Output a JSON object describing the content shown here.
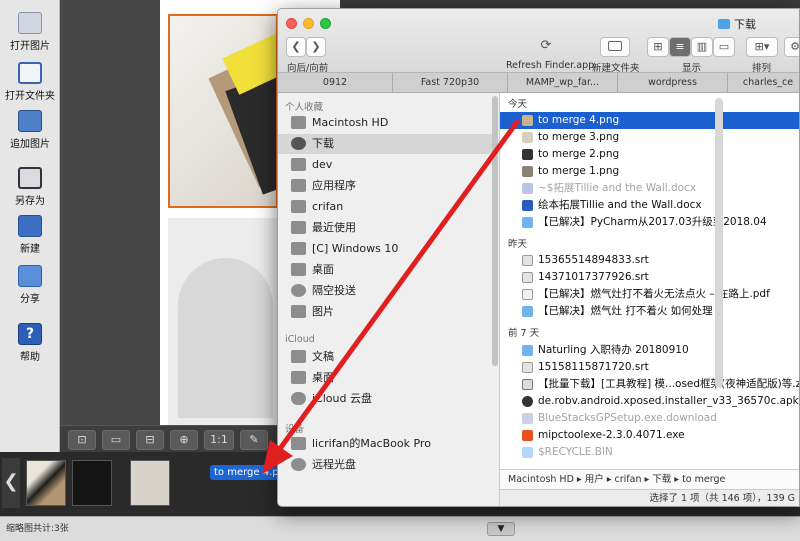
{
  "app": {
    "toolbar": [
      {
        "label": "打开图片",
        "icon": "open-image-icon"
      },
      {
        "label": "打开文件夹",
        "icon": "open-folder-icon"
      },
      {
        "label": "追加图片",
        "icon": "add-image-icon"
      },
      {
        "label": "另存为",
        "icon": "save-as-icon"
      },
      {
        "label": "新建",
        "icon": "new-icon"
      },
      {
        "label": "分享",
        "icon": "share-icon"
      },
      {
        "label": "帮助",
        "icon": "help-icon"
      }
    ],
    "bottom_tools": [
      "⊡",
      "▭",
      "⊟",
      "⊕",
      "1:1",
      "✎"
    ],
    "drag_label": "to merge 4.png",
    "status_text": "缩略图共计:3张",
    "collapse_icon": "▼",
    "nav_left": "❮"
  },
  "finder": {
    "title": "下载",
    "toolbar": {
      "back_forward": "向后/向前",
      "back": "❮",
      "forward": "❯",
      "refresh": "Refresh Finder.app",
      "new_folder": "新建文件夹",
      "display": "显示",
      "arrange": "排列"
    },
    "tabs": [
      "0912",
      "Fast 720p30",
      "MAMP_wp_far...",
      "wordpress",
      "charles_ce"
    ],
    "sidebar": {
      "favorites_header": "个人收藏",
      "favorites": [
        "Macintosh HD",
        "下载",
        "dev",
        "应用程序",
        "crifan",
        "最近使用",
        "[C] Windows 10",
        "桌面",
        "隔空投送",
        "图片"
      ],
      "icloud_header": "iCloud",
      "icloud": [
        "文稿",
        "桌面",
        "iCloud 云盘"
      ],
      "devices_header": "设备",
      "devices": [
        "licrifan的MacBook Pro",
        "远程光盘"
      ]
    },
    "groups": [
      {
        "header": "今天",
        "files": [
          {
            "name": "to merge 4.png",
            "selected": true
          },
          {
            "name": "to merge 3.png"
          },
          {
            "name": "to merge 2.png"
          },
          {
            "name": "to merge 1.png"
          },
          {
            "name": "~$拓展Tillie and the Wall.docx",
            "dim": true
          },
          {
            "name": "绘本拓展Tillie and the Wall.docx"
          },
          {
            "name": "【已解决】PyCharm从2017.03升级到2018.04"
          }
        ]
      },
      {
        "header": "昨天",
        "files": [
          {
            "name": "15365514894833.srt"
          },
          {
            "name": "14371017377926.srt"
          },
          {
            "name": "【已解决】燃气灶打不着火无法点火 – 在路上.pdf"
          },
          {
            "name": "【已解决】燃气灶 打不着火 如何处理"
          }
        ]
      },
      {
        "header": "前 7 天",
        "files": [
          {
            "name": "Naturling 入职待办 20180910"
          },
          {
            "name": "15158115871720.srt"
          },
          {
            "name": "【批量下载】[工具教程] 模...osed框架(夜神适配版)等.zip"
          },
          {
            "name": "de.robv.android.xposed.installer_v33_36570c.apk"
          },
          {
            "name": "BlueStacksGPSetup.exe.download",
            "dim": true
          },
          {
            "name": "mipctoolexe-2.3.0.4071.exe"
          },
          {
            "name": "$RECYCLE.BIN",
            "dim": true
          }
        ]
      }
    ],
    "pathbar": "Macintosh HD ▸ 用户 ▸ crifan ▸ 下载 ▸ to merge",
    "status": "选择了 1 项（共 146 项），139 G"
  },
  "colors": {
    "selection": "#1b60d0",
    "photo_border": "#e06b1a",
    "arrow": "#e02020"
  }
}
